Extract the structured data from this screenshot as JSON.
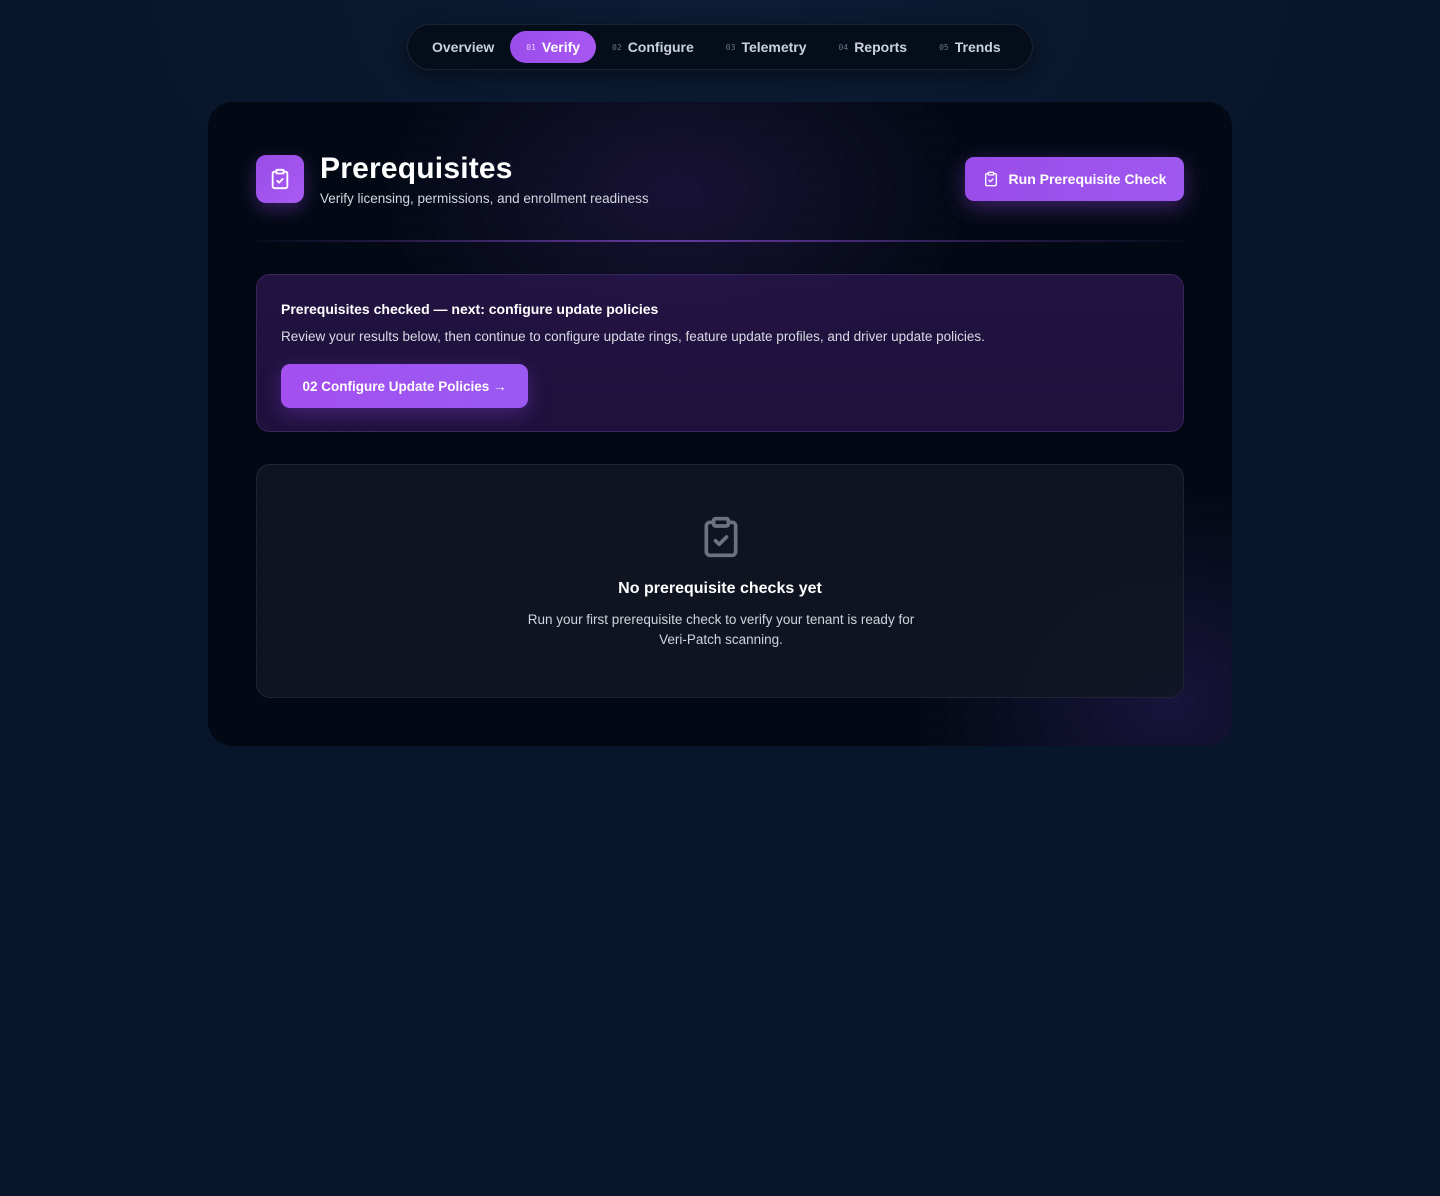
{
  "nav": {
    "items": [
      {
        "num": "",
        "label": "Overview",
        "active": false
      },
      {
        "num": "01",
        "label": "Verify",
        "active": true
      },
      {
        "num": "02",
        "label": "Configure",
        "active": false
      },
      {
        "num": "03",
        "label": "Telemetry",
        "active": false
      },
      {
        "num": "04",
        "label": "Reports",
        "active": false
      },
      {
        "num": "05",
        "label": "Trends",
        "active": false
      }
    ]
  },
  "header": {
    "icon": "clipboard-check-icon",
    "title": "Prerequisites",
    "subtitle": "Verify licensing, permissions, and enrollment readiness",
    "run_button_label": "Run Prerequisite Check"
  },
  "next_step": {
    "title": "Prerequisites checked — next: configure update policies",
    "description": "Review your results below, then continue to configure update rings, feature update profiles, and driver update policies.",
    "button_label": "02 Configure Update Policies →"
  },
  "empty_state": {
    "icon": "clipboard-check-icon",
    "title": "No prerequisite checks yet",
    "description": "Run your first prerequisite check to verify your tenant is ready for Veri-Patch scanning."
  },
  "colors": {
    "accent": "#9b4dea",
    "page_background": "#08162b",
    "card_background": "#030914"
  }
}
